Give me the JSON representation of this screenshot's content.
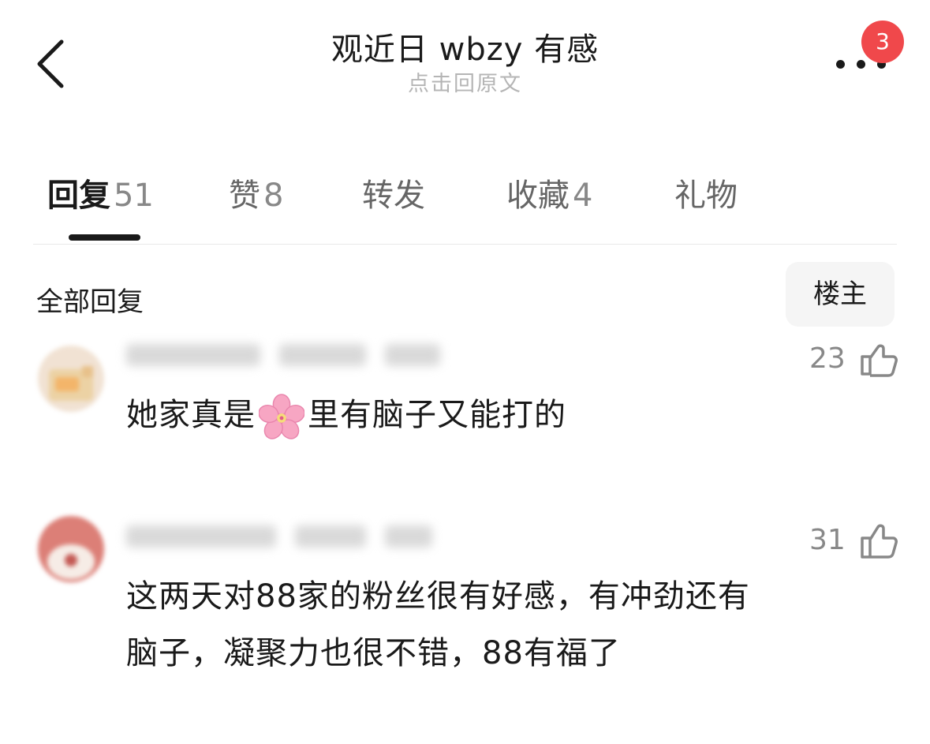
{
  "header": {
    "title": "观近日 wbzy 有感",
    "subtitle": "点击回原文",
    "notification_count": "3",
    "back_icon": "chevron-left-icon",
    "more_icon": "more-dots-icon"
  },
  "tabs": [
    {
      "label": "回复",
      "count": "51",
      "active": true
    },
    {
      "label": "赞",
      "count": "8",
      "active": false
    },
    {
      "label": "转发",
      "count": "",
      "active": false
    },
    {
      "label": "收藏",
      "count": "4",
      "active": false
    },
    {
      "label": "礼物",
      "count": "",
      "active": false
    }
  ],
  "replies_section": {
    "title": "全部回复",
    "filter_label": "楼主"
  },
  "comments": [
    {
      "text_before": "她家真是",
      "emoji": "cherry-blossom-emoji",
      "text_after": "里有脑子又能打的",
      "likes": "23"
    },
    {
      "text_line1": "这两天对88家的粉丝很有好感，有冲劲还有",
      "text_line2": "脑子，凝聚力也很不错，88有福了",
      "likes": "31"
    }
  ],
  "colors": {
    "badge": "#f0484b",
    "text_primary": "#1a1a1a",
    "text_secondary": "#888888",
    "subtitle": "#b5b5b5"
  }
}
